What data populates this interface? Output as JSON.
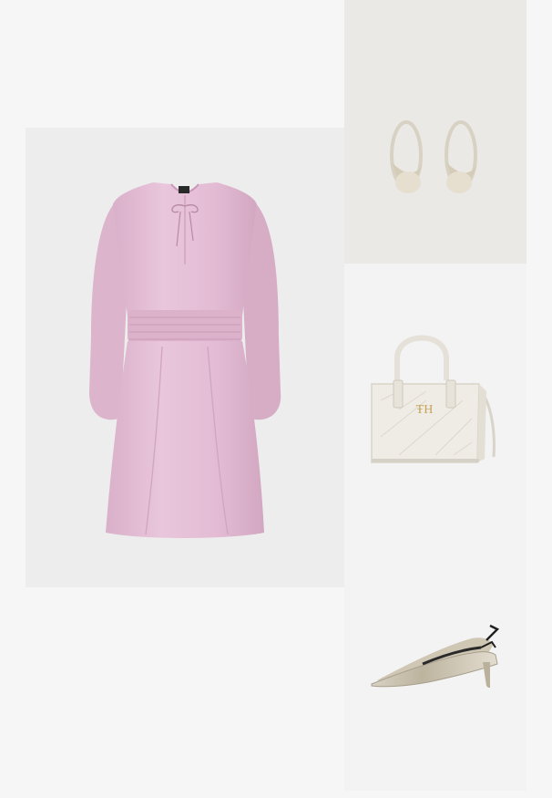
{
  "outfit": {
    "items": [
      {
        "id": "dress",
        "product_icon": "pink-satin-dress-icon",
        "background": "#ededed",
        "main_color": "#e4bfd6"
      },
      {
        "id": "earrings",
        "product_icon": "silver-hoop-earrings-icon",
        "background": "#ebe9e6",
        "main_color": "#dcd6c8"
      },
      {
        "id": "bag",
        "product_icon": "white-quilted-handbag-icon",
        "background": "#f3f3f3",
        "main_color": "#eeebe4"
      },
      {
        "id": "shoes",
        "product_icon": "metallic-slingback-pumps-icon",
        "background": "#f3f3f3",
        "main_color": "#c9c2b2"
      }
    ]
  }
}
